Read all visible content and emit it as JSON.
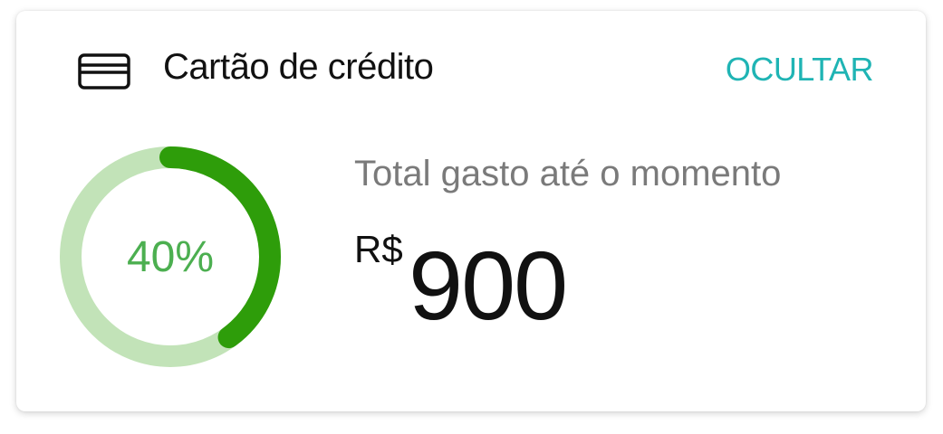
{
  "card": {
    "icon": "credit-card-icon",
    "title": "Cartão de crédito",
    "hide_label": "OCULTAR"
  },
  "progress": {
    "percent": 40,
    "label": "40%"
  },
  "spending": {
    "label": "Total gasto até o momento",
    "currency": "R$",
    "amount": "900"
  },
  "colors": {
    "accent": "#1fb4b4",
    "progress_fill": "#2e9d0a",
    "progress_track": "#c2e3b8",
    "percent_text": "#4caf50"
  }
}
